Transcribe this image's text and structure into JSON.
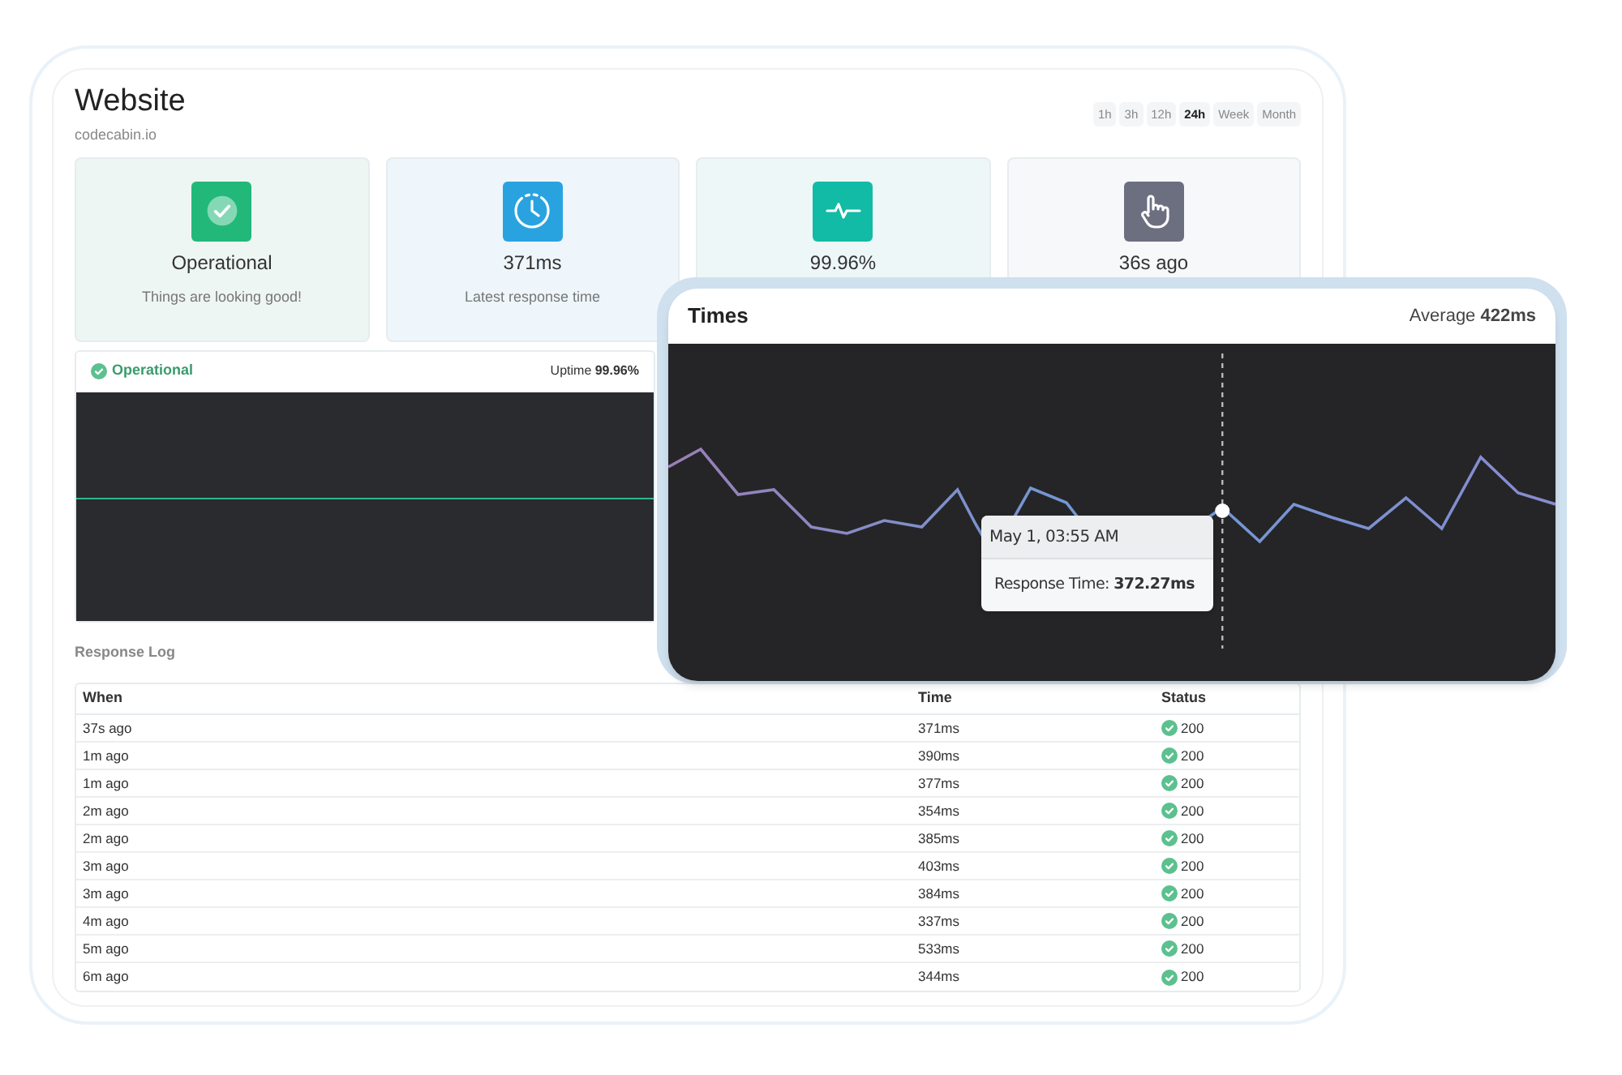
{
  "header": {
    "title": "Website",
    "subtitle": "codecabin.io"
  },
  "ranges": [
    {
      "label": "1h",
      "selected": false
    },
    {
      "label": "3h",
      "selected": false
    },
    {
      "label": "12h",
      "selected": false
    },
    {
      "label": "24h",
      "selected": true
    },
    {
      "label": "Week",
      "selected": false
    },
    {
      "label": "Month",
      "selected": false
    }
  ],
  "stats": [
    {
      "kind": "check",
      "color": "#22b87a",
      "value": "Operational",
      "caption": "Things are looking good!"
    },
    {
      "kind": "clock",
      "color": "#29a3e0",
      "value": "371ms",
      "caption": "Latest response time"
    },
    {
      "kind": "pulse",
      "color": "#12bba5",
      "value": "99.96%"
    },
    {
      "kind": "hand",
      "color": "#6b6f80",
      "value": "36s ago"
    }
  ],
  "uptime_panel": {
    "status": "Operational",
    "uptime": "Uptime **99.96%**"
  },
  "response_log": {
    "title": "Response Log",
    "columns": [
      "When",
      "Time",
      "Status"
    ],
    "rows": [
      {
        "when": "37s ago",
        "time": "371ms",
        "status": "200"
      },
      {
        "when": "1m ago",
        "time": "390ms",
        "status": "200"
      },
      {
        "when": "1m ago",
        "time": "377ms",
        "status": "200"
      },
      {
        "when": "2m ago",
        "time": "354ms",
        "status": "200"
      },
      {
        "when": "2m ago",
        "time": "385ms",
        "status": "200"
      },
      {
        "when": "3m ago",
        "time": "403ms",
        "status": "200"
      },
      {
        "when": "3m ago",
        "time": "384ms",
        "status": "200"
      },
      {
        "when": "4m ago",
        "time": "337ms",
        "status": "200"
      },
      {
        "when": "5m ago",
        "time": "533ms",
        "status": "200"
      },
      {
        "when": "6m ago",
        "time": "344ms",
        "status": "200"
      }
    ]
  },
  "times_card": {
    "title": "Times",
    "average": "Average **422ms**",
    "tooltip": {
      "date": "May 1, 03:55 AM",
      "reading": "Response Time: **372.27ms**"
    }
  }
}
